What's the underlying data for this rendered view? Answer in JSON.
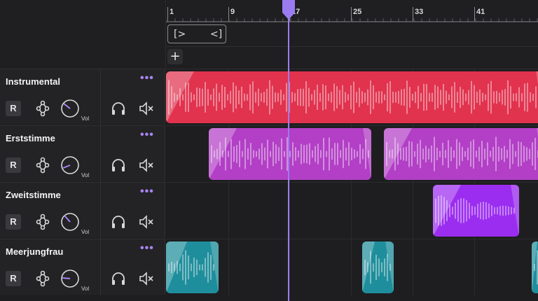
{
  "ruler": {
    "ticks": [
      "1",
      "9",
      "17",
      "25",
      "33",
      "41"
    ]
  },
  "add_track_label": "+",
  "tracks": [
    {
      "name": "Instrumental",
      "menu": "•••",
      "record": "R",
      "vol": "Vol",
      "color": "#e1324e",
      "icons": [
        "automation-icon",
        "volume-knob-icon",
        "headphones-icon",
        "mute-icon"
      ]
    },
    {
      "name": "Erststimme",
      "menu": "•••",
      "record": "R",
      "vol": "Vol",
      "color": "#b23fc6"
    },
    {
      "name": "Zweitstimme",
      "menu": "•••",
      "record": "R",
      "vol": "Vol",
      "color": "#9b2df0"
    },
    {
      "name": "Meerjungfrau",
      "menu": "•••",
      "record": "R",
      "vol": "Vol",
      "color": "#1f8e9c"
    }
  ],
  "colors": {
    "background": "#1e1e20",
    "playhead": "#9b7cf0",
    "accent_dots": "#a884f3"
  }
}
